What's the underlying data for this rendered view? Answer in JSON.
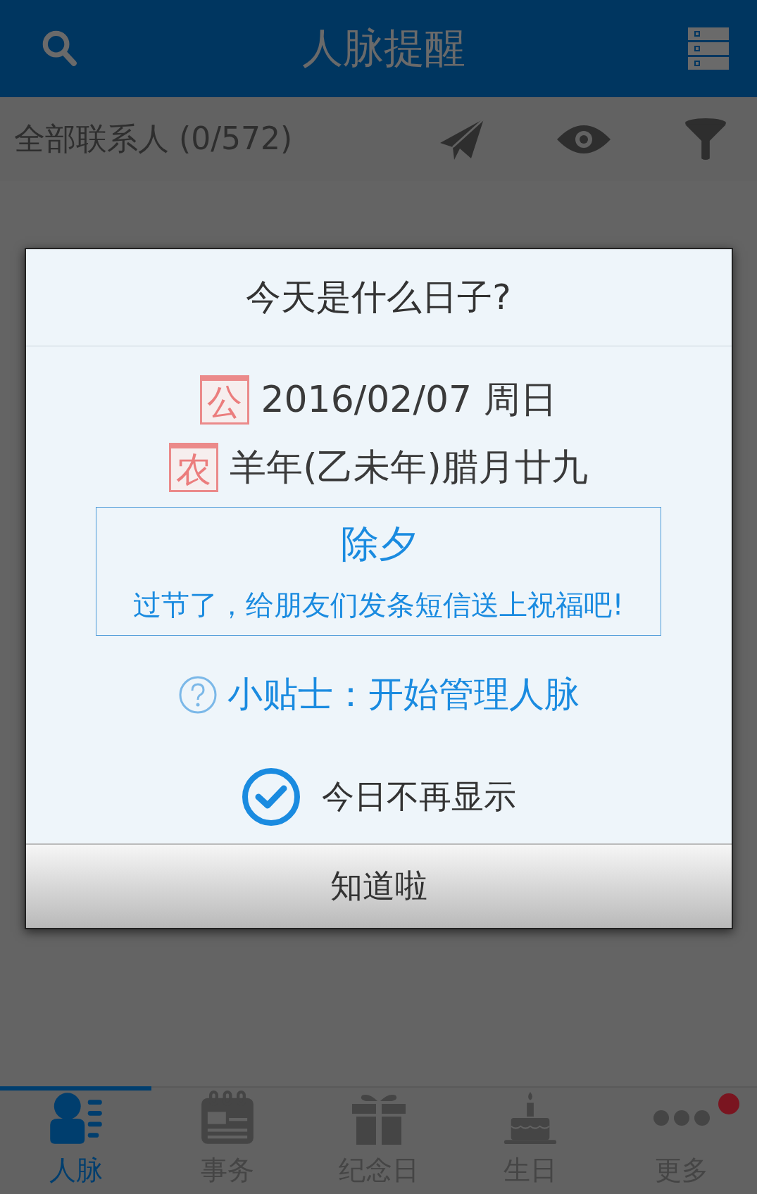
{
  "header": {
    "title": "人脉提醒"
  },
  "filter_bar": {
    "label": "全部联系人 (0/572)"
  },
  "dialog": {
    "title": "今天是什么日子?",
    "solar": {
      "badge": "公",
      "text": "2016/02/07 周日"
    },
    "lunar": {
      "badge": "农",
      "text": "羊年(乙未年)腊月廿九"
    },
    "festival": {
      "name": "除夕",
      "message": "过节了，给朋友们发条短信送上祝福吧!"
    },
    "tip": "小贴士：开始管理人脉",
    "dont_show": {
      "label": "今日不再显示",
      "checked": true
    },
    "button": "知道啦"
  },
  "nav": [
    {
      "label": "人脉",
      "kind": "contacts",
      "selected": true,
      "dot": false
    },
    {
      "label": "事务",
      "kind": "calendar",
      "selected": false,
      "dot": false
    },
    {
      "label": "纪念日",
      "kind": "gift",
      "selected": false,
      "dot": false
    },
    {
      "label": "生日",
      "kind": "cake",
      "selected": false,
      "dot": false
    },
    {
      "label": "更多",
      "kind": "more",
      "selected": false,
      "dot": true
    }
  ]
}
